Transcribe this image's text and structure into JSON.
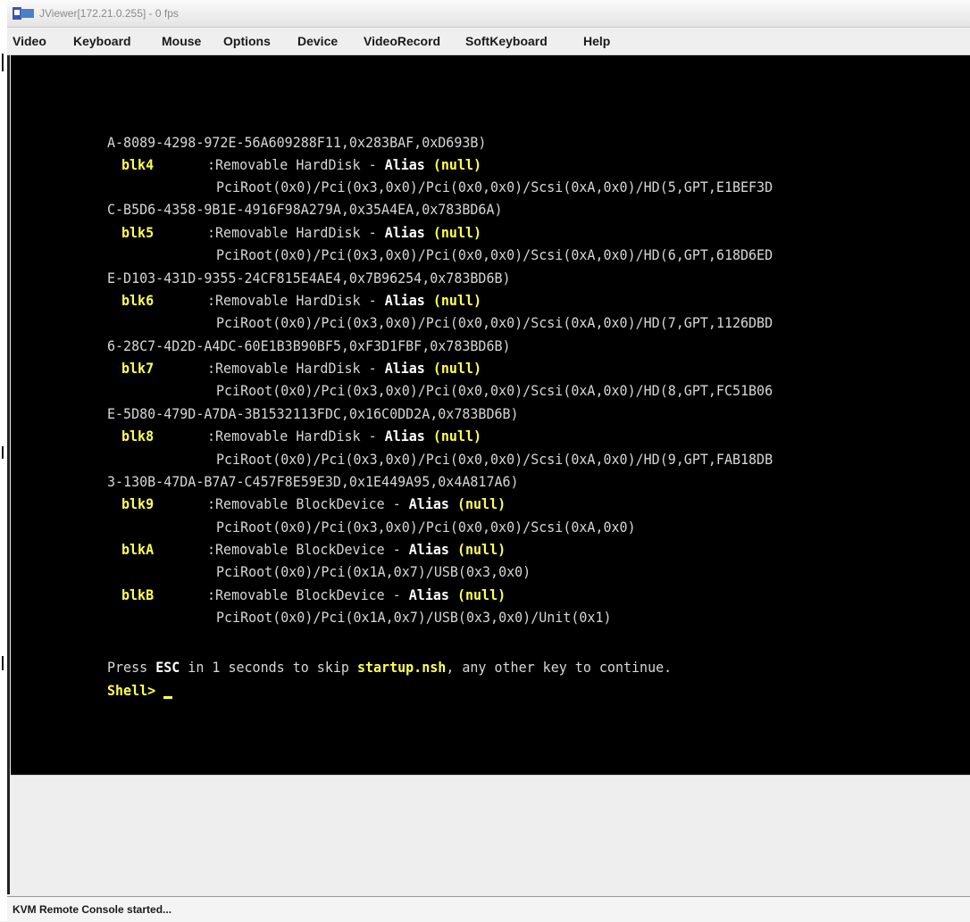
{
  "window": {
    "title": "JViewer[172.21.0.255] - 0 fps",
    "icon": "jviewer-app-icon"
  },
  "menu": {
    "items": [
      "Video",
      "Keyboard",
      "Mouse",
      "Options",
      "Device",
      "VideoRecord",
      "SoftKeyboard",
      "Help"
    ]
  },
  "console": {
    "colors": {
      "background": "#000000",
      "text": "#d6d6d6",
      "highlight": "#ffff4d",
      "bold": "#ffffff"
    },
    "lines": {
      "l01": "A-8089-4298-972E-56A609288F11,0x283BAF,0xD693B)",
      "l02_name": "blk4",
      "l02_text": ":Removable HardDisk - ",
      "l03": "PciRoot(0x0)/Pci(0x3,0x0)/Pci(0x0,0x0)/Scsi(0xA,0x0)/HD(5,GPT,E1BEF3D",
      "l04": "C-B5D6-4358-9B1E-4916F98A279A,0x35A4EA,0x783BD6A)",
      "l05_name": "blk5",
      "l05_text": ":Removable HardDisk - ",
      "l06": "PciRoot(0x0)/Pci(0x3,0x0)/Pci(0x0,0x0)/Scsi(0xA,0x0)/HD(6,GPT,618D6ED",
      "l07": "E-D103-431D-9355-24CF815E4AE4,0x7B96254,0x783BD6B)",
      "l08_name": "blk6",
      "l08_text": ":Removable HardDisk - ",
      "l09": "PciRoot(0x0)/Pci(0x3,0x0)/Pci(0x0,0x0)/Scsi(0xA,0x0)/HD(7,GPT,1126DBD",
      "l10": "6-28C7-4D2D-A4DC-60E1B3B90BF5,0xF3D1FBF,0x783BD6B)",
      "l11_name": "blk7",
      "l11_text": ":Removable HardDisk - ",
      "l12": "PciRoot(0x0)/Pci(0x3,0x0)/Pci(0x0,0x0)/Scsi(0xA,0x0)/HD(8,GPT,FC51B06",
      "l13": "E-5D80-479D-A7DA-3B1532113FDC,0x16C0DD2A,0x783BD6B)",
      "l14_name": "blk8",
      "l14_text": ":Removable HardDisk - ",
      "l15": "PciRoot(0x0)/Pci(0x3,0x0)/Pci(0x0,0x0)/Scsi(0xA,0x0)/HD(9,GPT,FAB18DB",
      "l16": "3-130B-47DA-B7A7-C457F8E59E3D,0x1E449A95,0x4A817A6)",
      "l17_name": "blk9",
      "l17_text": ":Removable BlockDevice - ",
      "l18": "PciRoot(0x0)/Pci(0x3,0x0)/Pci(0x0,0x0)/Scsi(0xA,0x0)",
      "l19_name": "blkA",
      "l19_text": ":Removable BlockDevice - ",
      "l20": "PciRoot(0x0)/Pci(0x1A,0x7)/USB(0x3,0x0)",
      "l21_name": "blkB",
      "l21_text": ":Removable BlockDevice - ",
      "l22": "PciRoot(0x0)/Pci(0x1A,0x7)/USB(0x3,0x0)/Unit(0x1)",
      "alias_label": "Alias",
      "alias_value": "(null)",
      "press_1": "Press ",
      "press_esc": "ESC",
      "press_2": " in 1 seconds to skip ",
      "press_file": "startup.nsh",
      "press_3": ", any other key to continue.",
      "prompt": "Shell> "
    }
  },
  "status": {
    "text": "KVM Remote Console started..."
  }
}
